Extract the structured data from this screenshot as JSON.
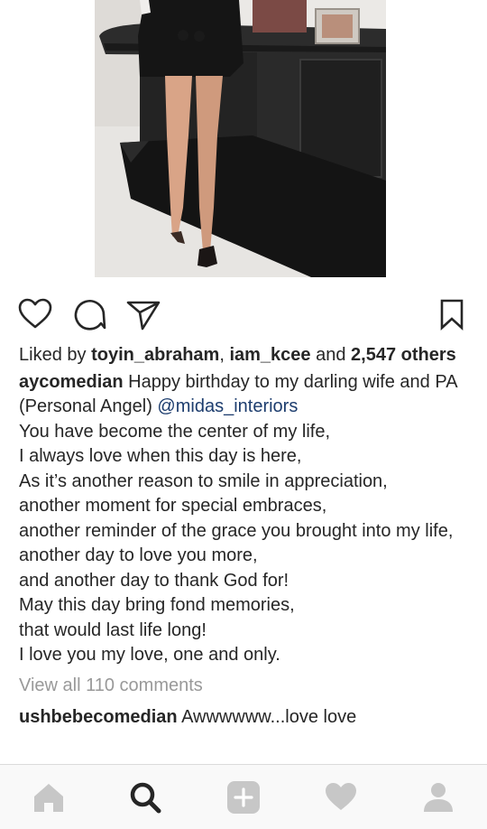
{
  "post": {
    "image_alt": "Woman in black dress and heels standing by an office desk",
    "liked_by_prefix": "Liked by ",
    "liked_user_1": "toyin_abraham",
    "liked_sep": ", ",
    "liked_user_2": "iam_kcee",
    "liked_and": " and ",
    "liked_others": "2,547 others",
    "author": "aycomedian",
    "caption_first": " Happy birthday to my darling wife and PA (Personal Angel) ",
    "caption_mention": "@midas_interiors",
    "caption_lines": [
      "You have become the center of my life,",
      "I always love when this day is here,",
      "As it’s another reason to smile in appreciation,",
      "another moment for special embraces,",
      "another reminder of the grace you brought into my life,",
      "another day to love you more,",
      "and another day to thank God for!",
      "May this day bring fond memories,",
      "that would last life long!",
      "I love you my love, one and only."
    ],
    "view_all_comments": "View all 110 comments",
    "comment_user": "ushbebecomedian",
    "comment_text": " Awwwwww...love love"
  },
  "actions": {
    "like": "heart-icon",
    "comment": "comment-icon",
    "share": "send-icon",
    "save": "bookmark-icon"
  },
  "nav": {
    "items": [
      "home-icon",
      "search-icon",
      "add-post-icon",
      "activity-heart-icon",
      "profile-icon"
    ]
  },
  "colors": {
    "text": "#262626",
    "muted": "#999999",
    "link": "#1d3d6e",
    "nav_icon_inactive": "#c7c7c7",
    "nav_icon_active": "#262626"
  }
}
